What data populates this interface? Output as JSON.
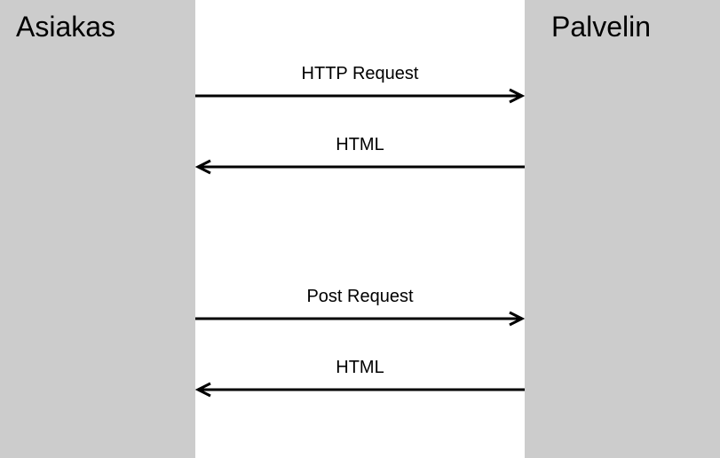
{
  "participants": {
    "left": "Asiakas",
    "right": "Palvelin"
  },
  "messages": [
    {
      "label": "HTTP Request",
      "direction": "right"
    },
    {
      "label": "HTML",
      "direction": "left"
    },
    {
      "label": "Post Request",
      "direction": "right"
    },
    {
      "label": "HTML",
      "direction": "left"
    }
  ]
}
